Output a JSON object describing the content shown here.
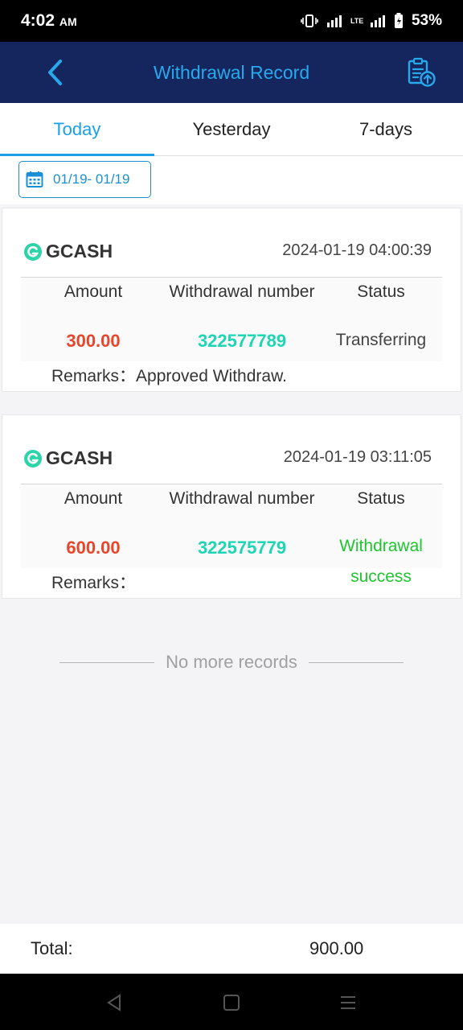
{
  "status_bar": {
    "time": "4:02",
    "ampm": "AM",
    "battery": "53%",
    "network": "LTE"
  },
  "header": {
    "title": "Withdrawal Record",
    "back_icon": "chevron-left-icon",
    "action_icon": "clipboard-upload-icon"
  },
  "tabs": [
    {
      "label": "Today",
      "active": true
    },
    {
      "label": "Yesterday",
      "active": false
    },
    {
      "label": "7-days",
      "active": false
    }
  ],
  "filter": {
    "date_range": "01/19- 01/19",
    "icon": "calendar-icon"
  },
  "columns": {
    "amount": "Amount",
    "number": "Withdrawal number",
    "status": "Status"
  },
  "records": [
    {
      "method": "GCASH",
      "time": "2024-01-19 04:00:39",
      "amount": "300.00",
      "number": "322577789",
      "status": "Transferring",
      "remarks": "Remarks：Approved Withdraw."
    },
    {
      "method": "GCASH",
      "time": "2024-01-19 03:11:05",
      "amount": "600.00",
      "number": "322575779",
      "status_line1": "Withdrawal",
      "status_line2": "success",
      "remarks": "Remarks："
    }
  ],
  "no_more": "No more records",
  "total": {
    "label": "Total:",
    "value": "900.00"
  },
  "colors": {
    "header_bg": "#14265d",
    "accent": "#1aa0e6",
    "amount": "#e8462c",
    "number": "#1dd6b4",
    "success": "#1fc52f"
  }
}
